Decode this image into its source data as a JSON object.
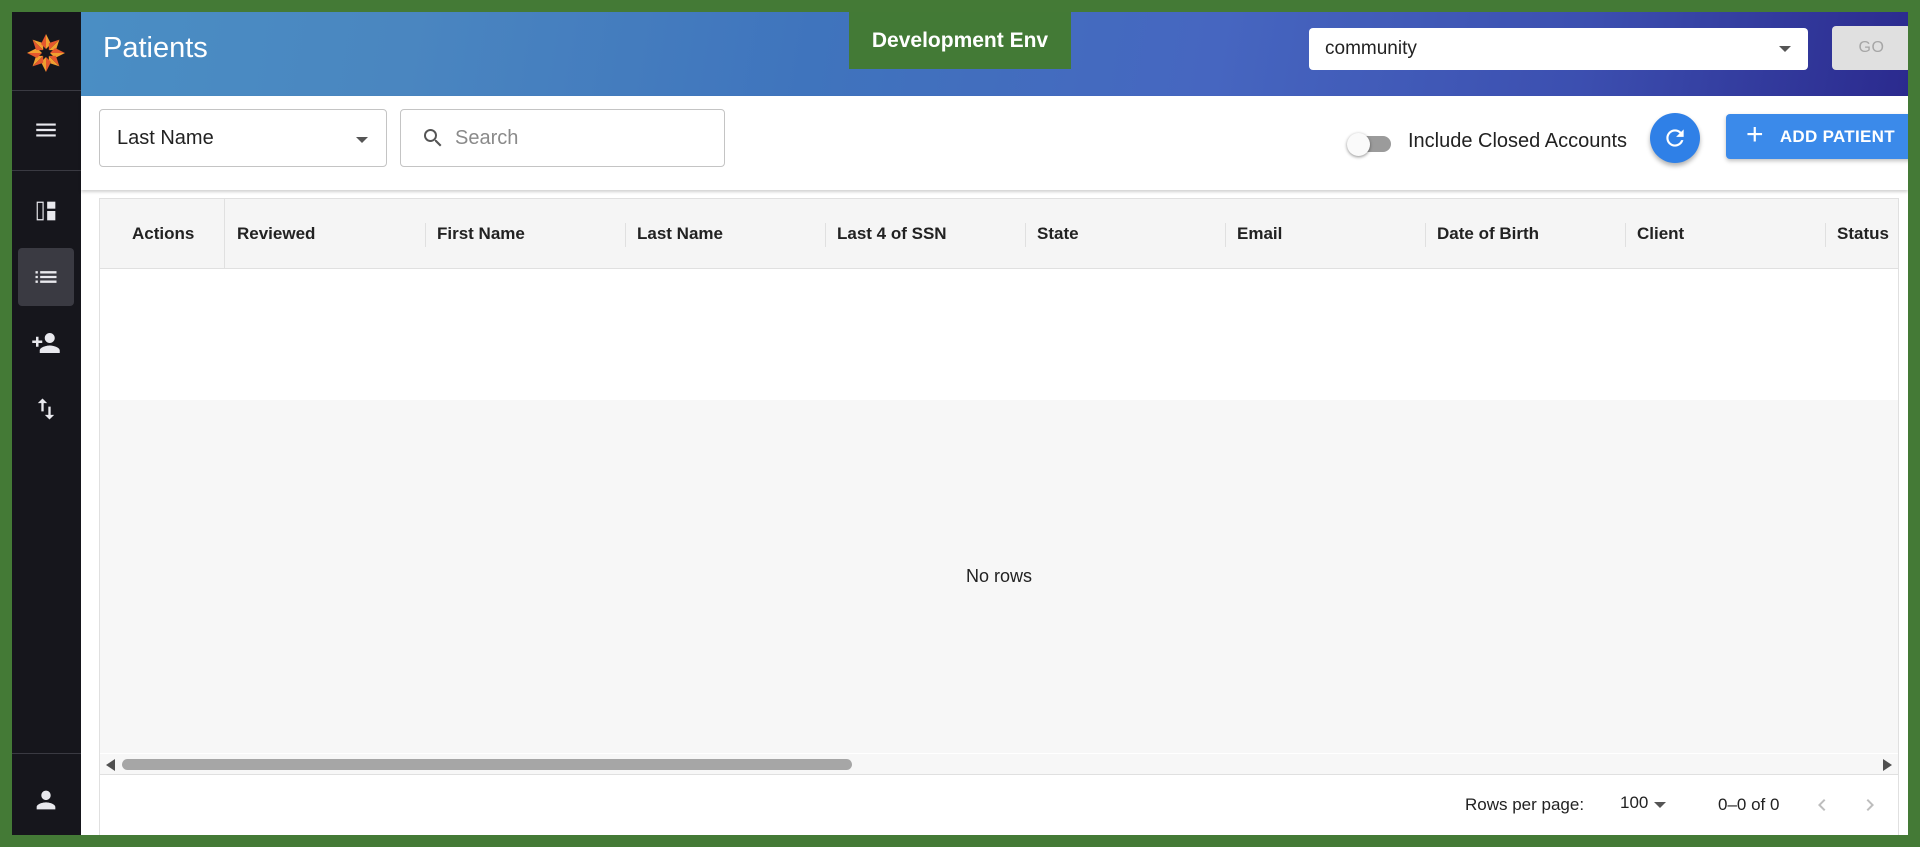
{
  "header": {
    "title": "Patients",
    "env_badge": "Development Env",
    "org_select_value": "community",
    "go_label": "GO"
  },
  "sidebar": {
    "items": [
      {
        "name": "menu",
        "icon": "menu-icon"
      },
      {
        "name": "dashboard",
        "icon": "dashboard-icon"
      },
      {
        "name": "patients-list",
        "icon": "list-icon",
        "active": true
      },
      {
        "name": "add-person",
        "icon": "person-add-icon"
      },
      {
        "name": "transfer",
        "icon": "import-export-icon"
      },
      {
        "name": "account",
        "icon": "person-icon"
      }
    ]
  },
  "toolbar": {
    "search_field_value": "Last Name",
    "search_placeholder": "Search",
    "include_closed_label": "Include Closed Accounts",
    "include_closed_checked": false,
    "add_patient_label": "ADD PATIENT"
  },
  "grid": {
    "columns": [
      "Actions",
      "Reviewed",
      "First Name",
      "Last Name",
      "Last 4 of SSN",
      "State",
      "Email",
      "Date of Birth",
      "Client",
      "Status"
    ],
    "rows": [],
    "empty_text": "No rows"
  },
  "pagination": {
    "rows_per_page_label": "Rows per page:",
    "rows_per_page_value": "100",
    "range_text": "0–0 of 0"
  },
  "colors": {
    "frame_border": "#447a36",
    "sidebar": "#16161c",
    "accent_blue": "#3b8aea",
    "env_badge": "#437a36"
  }
}
